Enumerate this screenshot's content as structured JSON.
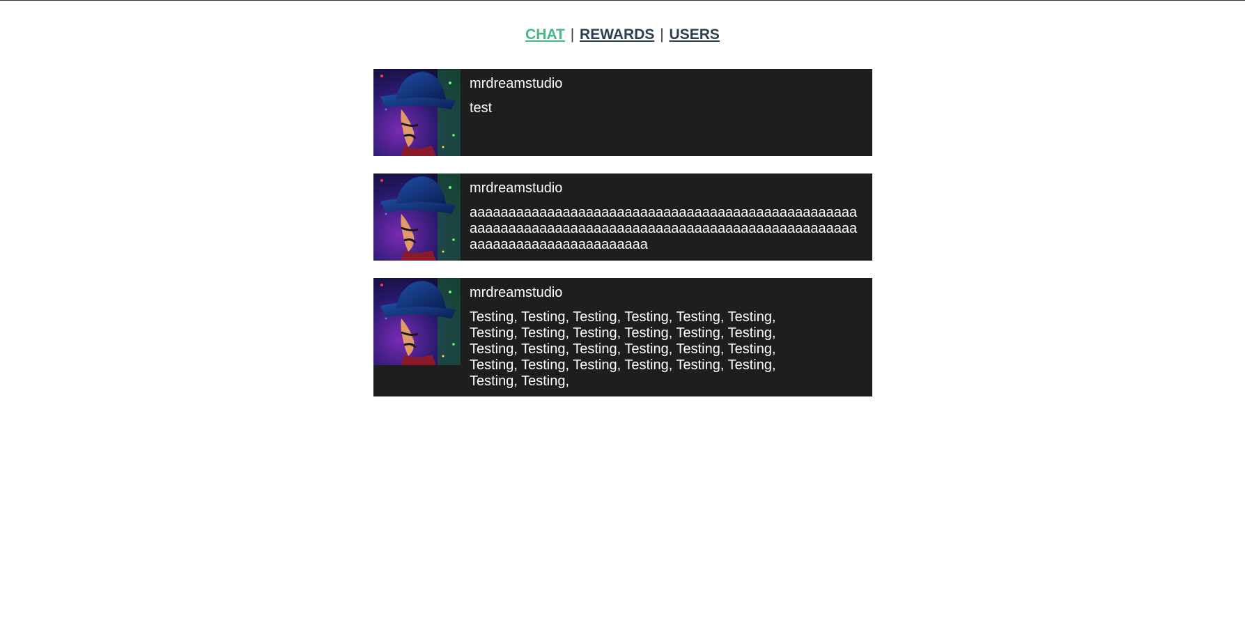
{
  "nav": {
    "chat": "CHAT",
    "rewards": "REWARDS",
    "users": "USERS",
    "separator": "|",
    "active_color": "#42b983",
    "inactive_color": "#2c3e50"
  },
  "messages": [
    {
      "username": "mrdreamstudio",
      "text": "test",
      "avatar_icon": "wizard-avatar-icon"
    },
    {
      "username": "mrdreamstudio",
      "text": "aaaaaaaaaaaaaaaaaaaaaaaaaaaaaaaaaaaaaaaaaaaaaaaaaaaaaaaaaaaaaaaaaaaaaaaaaaaaaaaaaaaaaaaaaaaaaaaaaaaaaaaaaaaaaaaaaaaaaaaaaaa",
      "avatar_icon": "wizard-avatar-icon"
    },
    {
      "username": "mrdreamstudio",
      "text": "Testing, Testing, Testing, Testing, Testing, Testing, Testing, Testing, Testing, Testing, Testing, Testing, Testing, Testing, Testing, Testing, Testing, Testing, Testing, Testing, Testing, Testing, Testing, Testing, Testing, Testing,",
      "avatar_icon": "wizard-avatar-icon"
    }
  ],
  "colors": {
    "message_bg": "#1e1e1e",
    "message_text": "#ffffff"
  }
}
